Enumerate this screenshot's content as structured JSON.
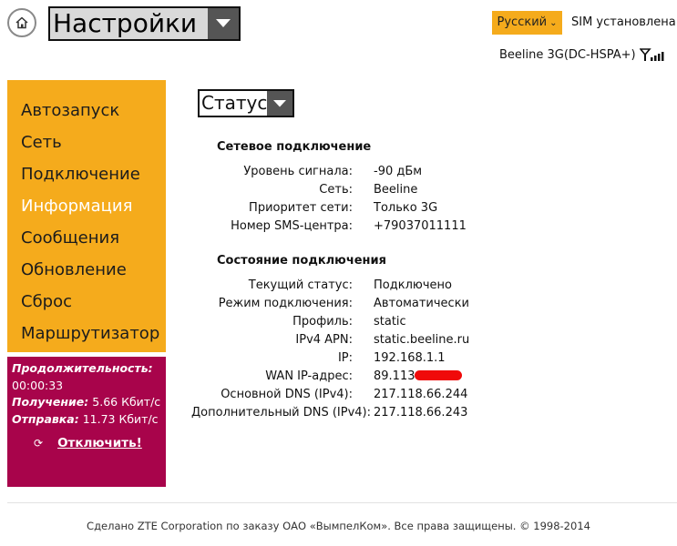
{
  "header": {
    "page_title": "Настройки",
    "language": "Русский",
    "sim_status": "SIM установлена",
    "network": "Beeline 3G(DC-HSPA+)"
  },
  "sidebar": {
    "items": [
      {
        "label": "Автозапуск"
      },
      {
        "label": "Сеть"
      },
      {
        "label": "Подключение"
      },
      {
        "label": "Информация",
        "active": true
      },
      {
        "label": "Сообщения"
      },
      {
        "label": "Обновление"
      },
      {
        "label": "Сброс"
      },
      {
        "label": "Маршрутизатор"
      }
    ]
  },
  "connection": {
    "duration_label": "Продолжительность:",
    "duration_value": "00:00:33",
    "received_label": "Получение:",
    "received_value": "5.66 Кбит/с",
    "sent_label": "Отправка:",
    "sent_value": "11.73 Кбит/с",
    "disconnect_label": "Отключить!"
  },
  "status_select": "Статус",
  "network_section": {
    "title": "Сетевое подключение",
    "rows": [
      {
        "key": "Уровень сигнала:",
        "value": "-90 дБм"
      },
      {
        "key": "Сеть:",
        "value": "Beeline"
      },
      {
        "key": "Приоритет сети:",
        "value": "Только 3G"
      },
      {
        "key": "Номер SMS-центра:",
        "value": "+79037011111"
      }
    ]
  },
  "connection_section": {
    "title": "Состояние подключения",
    "rows": [
      {
        "key": "Текущий статус:",
        "value": "Подключено"
      },
      {
        "key": "Режим подключения:",
        "value": "Автоматически"
      },
      {
        "key": "Профиль:",
        "value": "static"
      },
      {
        "key": "IPv4 APN:",
        "value": "static.beeline.ru"
      },
      {
        "key": "IP:",
        "value": "192.168.1.1"
      },
      {
        "key": "WAN IP-адрес:",
        "value": "89.113"
      },
      {
        "key": "Основной DNS (IPv4):",
        "value": "217.118.66.244"
      },
      {
        "key": "Дополнительный DNS (IPv4):",
        "value": "217.118.66.243"
      }
    ]
  },
  "footer": "Сделано ZTE Corporation по заказу ОАО «ВымпелКом». Все права защищены. © 1998-2014",
  "colors": {
    "accent_orange": "#f5ab1c",
    "panel_crimson": "#a8044b",
    "redaction": "#f00a0a"
  },
  "icons": [
    "home-icon",
    "chevron-down-icon",
    "signal-antenna-icon",
    "refresh-icon"
  ]
}
